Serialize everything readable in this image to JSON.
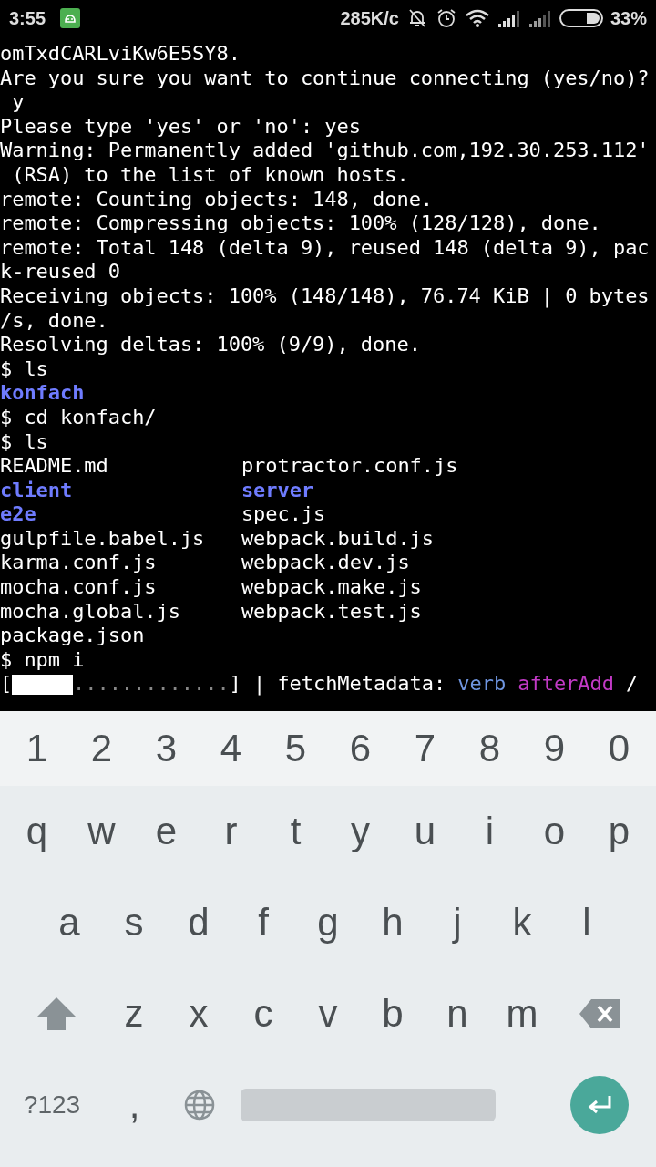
{
  "status_bar": {
    "time": "3:55",
    "speed": "285K/c",
    "battery": "33%"
  },
  "terminal": {
    "lines": [
      {
        "kind": "text",
        "segments": [
          {
            "text": "omTxdCARLviKw6E5SY8.",
            "kind": "plain"
          }
        ]
      },
      {
        "kind": "text",
        "segments": [
          {
            "text": "Are you sure you want to continue connecting (yes/no)?",
            "kind": "plain"
          }
        ]
      },
      {
        "kind": "text",
        "segments": [
          {
            "text": " y",
            "kind": "plain"
          }
        ]
      },
      {
        "kind": "text",
        "segments": [
          {
            "text": "Please type 'yes' or 'no': yes",
            "kind": "plain"
          }
        ]
      },
      {
        "kind": "text",
        "segments": [
          {
            "text": "Warning: Permanently added 'github.com,192.30.253.112'",
            "kind": "plain"
          }
        ]
      },
      {
        "kind": "text",
        "segments": [
          {
            "text": " (RSA) to the list of known hosts.",
            "kind": "plain"
          }
        ]
      },
      {
        "kind": "text",
        "segments": [
          {
            "text": "remote: Counting objects: 148, done.",
            "kind": "plain"
          }
        ]
      },
      {
        "kind": "text",
        "segments": [
          {
            "text": "remote: Compressing objects: 100% (128/128), done.",
            "kind": "plain"
          }
        ]
      },
      {
        "kind": "text",
        "segments": [
          {
            "text": "remote: Total 148 (delta 9), reused 148 (delta 9), pac",
            "kind": "plain"
          }
        ]
      },
      {
        "kind": "text",
        "segments": [
          {
            "text": "k-reused 0",
            "kind": "plain"
          }
        ]
      },
      {
        "kind": "text",
        "segments": [
          {
            "text": "Receiving objects: 100% (148/148), 76.74 KiB | 0 bytes",
            "kind": "plain"
          }
        ]
      },
      {
        "kind": "text",
        "segments": [
          {
            "text": "/s, done.",
            "kind": "plain"
          }
        ]
      },
      {
        "kind": "text",
        "segments": [
          {
            "text": "Resolving deltas: 100% (9/9), done.",
            "kind": "plain"
          }
        ]
      },
      {
        "kind": "text",
        "segments": [
          {
            "text": "$ ls",
            "kind": "plain"
          }
        ]
      },
      {
        "kind": "text",
        "segments": [
          {
            "text": "konfach",
            "kind": "dir"
          }
        ]
      },
      {
        "kind": "text",
        "segments": [
          {
            "text": "$ cd konfach/",
            "kind": "plain"
          }
        ]
      },
      {
        "kind": "text",
        "segments": [
          {
            "text": "$ ls",
            "kind": "plain"
          }
        ]
      },
      {
        "kind": "listing",
        "columns": [
          {
            "text": "README.md",
            "kind": "plain"
          },
          {
            "text": "protractor.conf.js",
            "kind": "plain"
          }
        ]
      },
      {
        "kind": "listing",
        "columns": [
          {
            "text": "client",
            "kind": "dir"
          },
          {
            "text": "server",
            "kind": "dir"
          }
        ]
      },
      {
        "kind": "listing",
        "columns": [
          {
            "text": "e2e",
            "kind": "dir"
          },
          {
            "text": "spec.js",
            "kind": "plain"
          }
        ]
      },
      {
        "kind": "listing",
        "columns": [
          {
            "text": "gulpfile.babel.js",
            "kind": "plain"
          },
          {
            "text": "webpack.build.js",
            "kind": "plain"
          }
        ]
      },
      {
        "kind": "listing",
        "columns": [
          {
            "text": "karma.conf.js",
            "kind": "plain"
          },
          {
            "text": "webpack.dev.js",
            "kind": "plain"
          }
        ]
      },
      {
        "kind": "listing",
        "columns": [
          {
            "text": "mocha.conf.js",
            "kind": "plain"
          },
          {
            "text": "webpack.make.js",
            "kind": "plain"
          }
        ]
      },
      {
        "kind": "listing",
        "columns": [
          {
            "text": "mocha.global.js",
            "kind": "plain"
          },
          {
            "text": "webpack.test.js",
            "kind": "plain"
          }
        ]
      },
      {
        "kind": "text",
        "segments": [
          {
            "text": "package.json",
            "kind": "plain"
          }
        ]
      },
      {
        "kind": "text",
        "segments": [
          {
            "text": "$ npm i",
            "kind": "plain"
          }
        ]
      },
      {
        "kind": "progress",
        "open": "[",
        "level": 0.28,
        "dots": ".............",
        "close": "]",
        "segments": [
          {
            "text": " | fetchMetadata: ",
            "kind": "plain"
          },
          {
            "text": "verb",
            "kind": "verb"
          },
          {
            "text": " afterAdd",
            "kind": "afterAdd"
          },
          {
            "text": " /",
            "kind": "plain"
          }
        ]
      }
    ]
  },
  "keyboard": {
    "rows": [
      {
        "kind": "numbers",
        "keys": [
          {
            "kind": "char",
            "label": "1"
          },
          {
            "kind": "char",
            "label": "2"
          },
          {
            "kind": "char",
            "label": "3"
          },
          {
            "kind": "char",
            "label": "4"
          },
          {
            "kind": "char",
            "label": "5"
          },
          {
            "kind": "char",
            "label": "6"
          },
          {
            "kind": "char",
            "label": "7"
          },
          {
            "kind": "char",
            "label": "8"
          },
          {
            "kind": "char",
            "label": "9"
          },
          {
            "kind": "char",
            "label": "0"
          }
        ]
      },
      {
        "kind": "letters",
        "keys": [
          {
            "kind": "char",
            "label": "q"
          },
          {
            "kind": "char",
            "label": "w"
          },
          {
            "kind": "char",
            "label": "e"
          },
          {
            "kind": "char",
            "label": "r"
          },
          {
            "kind": "char",
            "label": "t"
          },
          {
            "kind": "char",
            "label": "y"
          },
          {
            "kind": "char",
            "label": "u"
          },
          {
            "kind": "char",
            "label": "i"
          },
          {
            "kind": "char",
            "label": "o"
          },
          {
            "kind": "char",
            "label": "p"
          }
        ]
      },
      {
        "kind": "letters",
        "keys": [
          {
            "kind": "char",
            "label": "a"
          },
          {
            "kind": "char",
            "label": "s"
          },
          {
            "kind": "char",
            "label": "d"
          },
          {
            "kind": "char",
            "label": "f"
          },
          {
            "kind": "char",
            "label": "g"
          },
          {
            "kind": "char",
            "label": "h"
          },
          {
            "kind": "char",
            "label": "j"
          },
          {
            "kind": "char",
            "label": "k"
          },
          {
            "kind": "char",
            "label": "l"
          }
        ]
      },
      {
        "kind": "letters",
        "keys": [
          {
            "kind": "shift"
          },
          {
            "kind": "char",
            "label": "z"
          },
          {
            "kind": "char",
            "label": "x"
          },
          {
            "kind": "char",
            "label": "c"
          },
          {
            "kind": "char",
            "label": "v"
          },
          {
            "kind": "char",
            "label": "b"
          },
          {
            "kind": "char",
            "label": "n"
          },
          {
            "kind": "char",
            "label": "m"
          },
          {
            "kind": "backspace"
          }
        ]
      },
      {
        "kind": "bottom",
        "keys": [
          {
            "kind": "symbols",
            "label": "?123"
          },
          {
            "kind": "char",
            "label": ","
          },
          {
            "kind": "globe"
          },
          {
            "kind": "space"
          },
          {
            "kind": "enter"
          }
        ]
      }
    ]
  }
}
